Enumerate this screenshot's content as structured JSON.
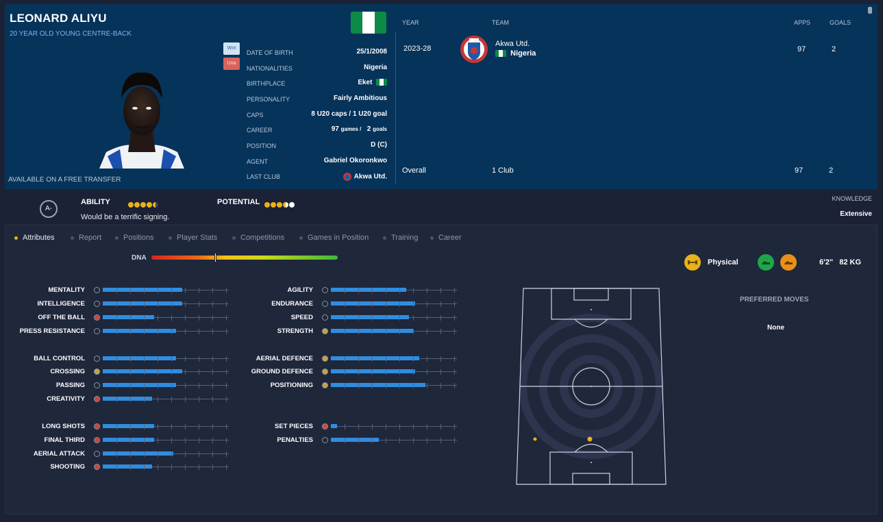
{
  "player": {
    "name": "LEONARD ALIYU",
    "subtitle": "20 YEAR OLD YOUNG CENTRE-BACK",
    "transfer_status": "AVAILABLE ON A FREE TRANSFER",
    "tags": [
      "Wnt",
      "Una"
    ]
  },
  "info": {
    "dob_label": "DATE OF BIRTH",
    "dob": "25/1/2008",
    "nat_label": "NATIONALITIES",
    "nat": "Nigeria",
    "birth_label": "BIRTHPLACE",
    "birth": "Eket",
    "pers_label": "PERSONALITY",
    "pers": "Fairly Ambitious",
    "caps_label": "CAPS",
    "caps": "8 U20 caps / 1 U20 goal",
    "career_label": "CAREER",
    "career_games": "97",
    "career_games_unit": "games /",
    "career_goals": "2",
    "career_goals_unit": "goals",
    "pos_label": "POSITION",
    "pos": "D (C)",
    "agent_label": "AGENT",
    "agent": "Gabriel Okoronkwo",
    "last_label": "LAST CLUB",
    "last": "Akwa Utd."
  },
  "history": {
    "headers": {
      "year": "YEAR",
      "team": "TEAM",
      "apps": "APPS",
      "goals": "GOALS"
    },
    "rows": [
      {
        "year": "2023-28",
        "team": "Akwa Utd.",
        "country": "Nigeria",
        "apps": "97",
        "goals": "2"
      }
    ],
    "overall": {
      "label": "Overall",
      "clubs": "1 Club",
      "apps": "97",
      "goals": "2"
    }
  },
  "ratings": {
    "ca_badge": "A-",
    "ability_label": "ABILITY",
    "ability_stars": 4.5,
    "potential_label": "POTENTIAL",
    "potential_stars": 4.5,
    "recommendation": "Would be a terrific signing.",
    "knowledge_label": "KNOWLEDGE",
    "knowledge": "Extensive"
  },
  "tabs": [
    "Attributes",
    "Report",
    "Positions",
    "Player Stats",
    "Competitions",
    "Games in Position",
    "Training",
    "Career"
  ],
  "dna_label": "DNA",
  "dna_level": 0.34,
  "attributes_left": [
    {
      "name": "MENTALITY",
      "value": 0.63
    },
    {
      "name": "INTELLIGENCE",
      "value": 0.63
    },
    {
      "name": "OFF THE BALL",
      "value": 0.41
    },
    {
      "name": "PRESS RESISTANCE",
      "value": 0.58
    },
    {
      "name": "BALL CONTROL",
      "value": 0.58
    },
    {
      "name": "CROSSING",
      "value": 0.63
    },
    {
      "name": "PASSING",
      "value": 0.58
    },
    {
      "name": "CREATIVITY",
      "value": 0.39
    },
    {
      "name": "LONG SHOTS",
      "value": 0.41
    },
    {
      "name": "FINAL THIRD",
      "value": 0.41
    },
    {
      "name": "AERIAL ATTACK",
      "value": 0.56
    },
    {
      "name": "SHOOTING",
      "value": 0.39
    }
  ],
  "attributes_right": [
    {
      "name": "AGILITY",
      "value": 0.6
    },
    {
      "name": "ENDURANCE",
      "value": 0.67
    },
    {
      "name": "SPEED",
      "value": 0.62
    },
    {
      "name": "STRENGTH",
      "value": 0.65
    },
    {
      "name": "AERIAL DEFENCE",
      "value": 0.7
    },
    {
      "name": "GROUND DEFENCE",
      "value": 0.67
    },
    {
      "name": "POSITIONING",
      "value": 0.75
    },
    {
      "name": "SET PIECES",
      "value": 0.05
    },
    {
      "name": "PENALTIES",
      "value": 0.38
    }
  ],
  "physical": {
    "label": "Physical",
    "height": "6'2\"",
    "weight": "82 KG"
  },
  "preferred_moves": {
    "title": "PREFERRED MOVES",
    "value": "None"
  },
  "colors": {
    "accent": "#e8b21a",
    "bar": "#2f8de0",
    "panel": "#06335a"
  }
}
